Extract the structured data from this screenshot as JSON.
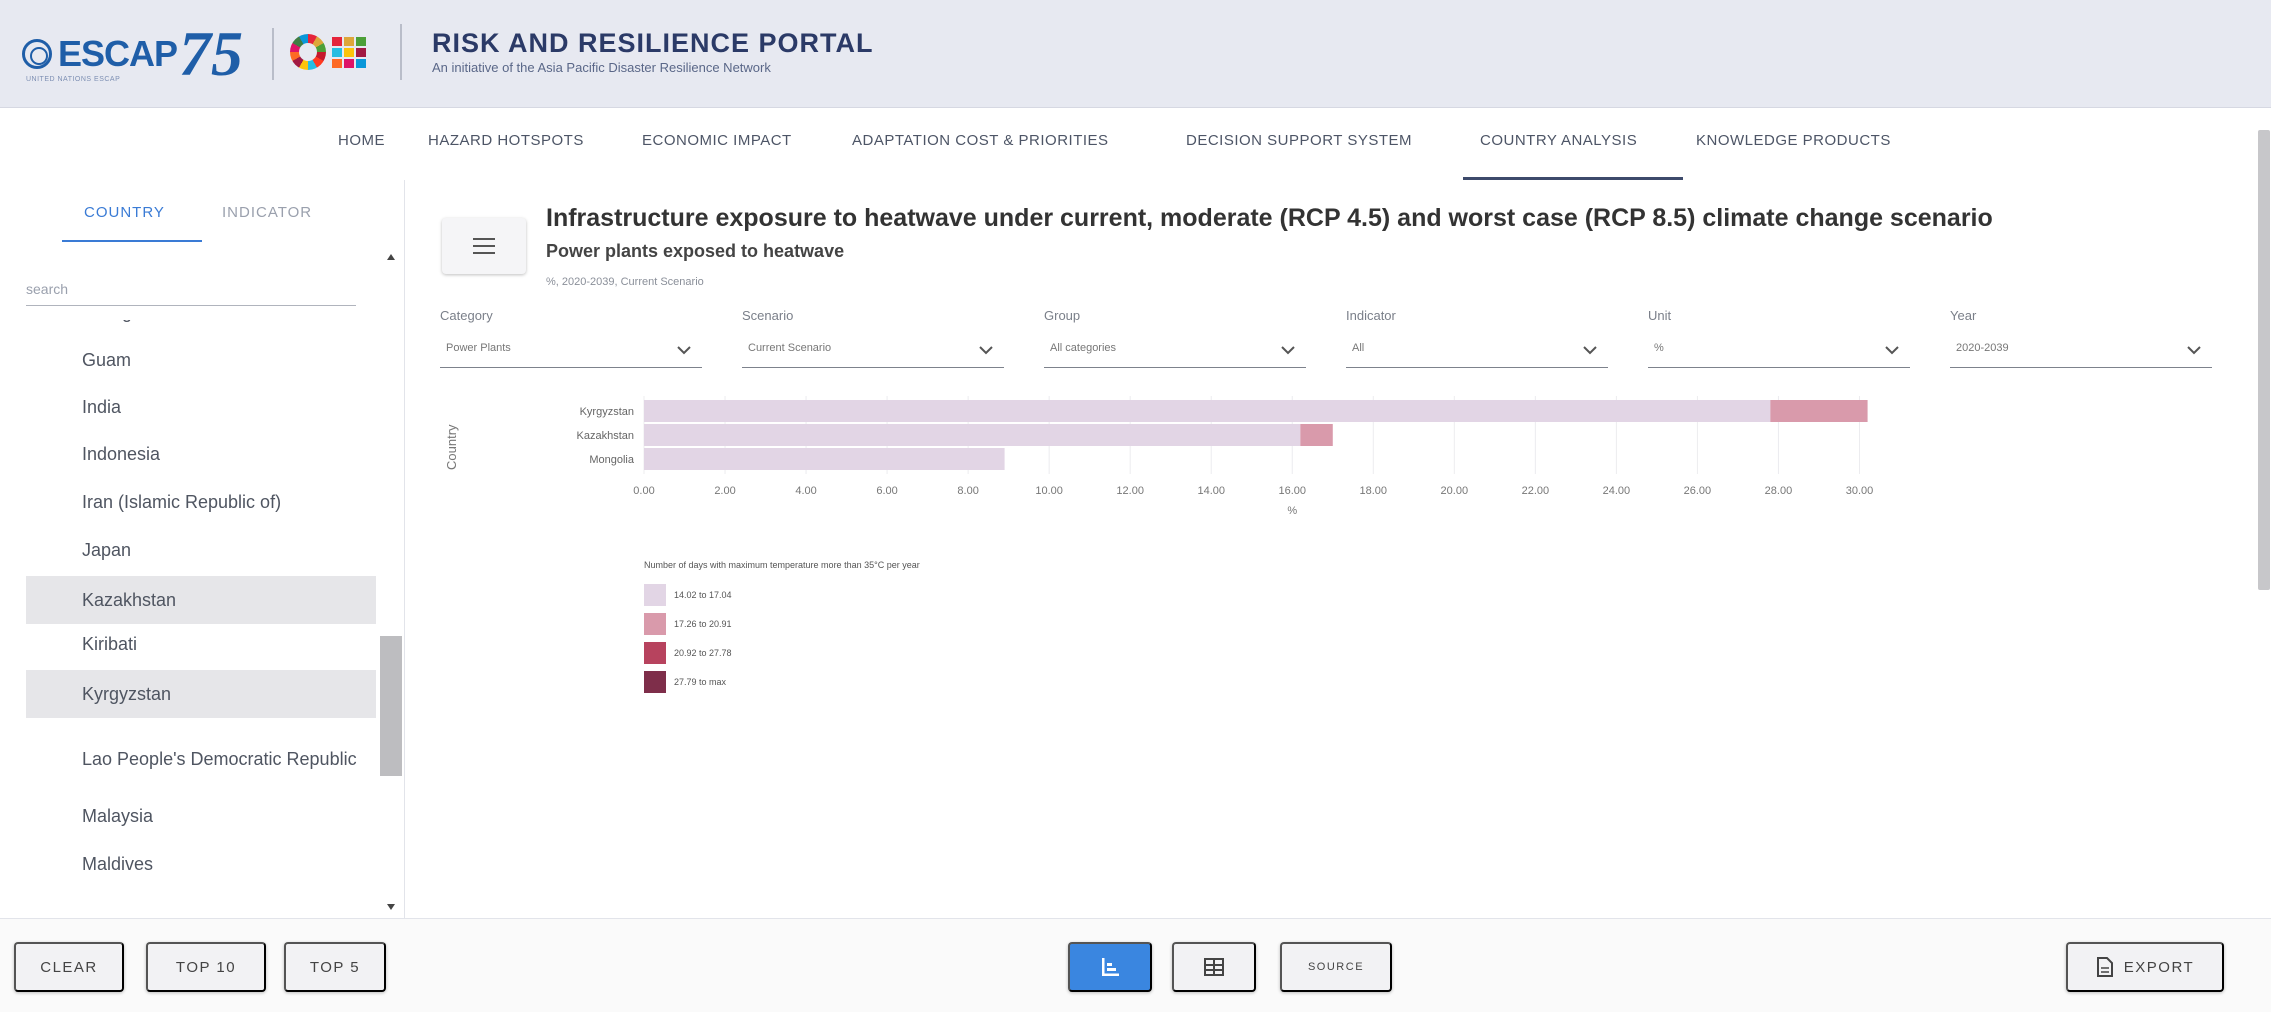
{
  "header": {
    "logo_text": "ESCAP",
    "logo_number": "75",
    "logo_subtext": "UNITED NATIONS ESCAP",
    "portal_title": "RISK AND RESILIENCE PORTAL",
    "portal_subtitle": "An initiative of the Asia Pacific Disaster Resilience Network"
  },
  "nav": {
    "items": [
      "HOME",
      "HAZARD HOTSPOTS",
      "ECONOMIC IMPACT",
      "ADAPTATION COST & PRIORITIES",
      "DECISION SUPPORT SYSTEM",
      "COUNTRY ANALYSIS",
      "KNOWLEDGE PRODUCTS"
    ],
    "active": "COUNTRY ANALYSIS"
  },
  "sidebar": {
    "tabs": [
      "COUNTRY",
      "INDICATOR"
    ],
    "active_tab": "COUNTRY",
    "search_placeholder": "search",
    "countries": [
      "Georgia",
      "Guam",
      "India",
      "Indonesia",
      "Iran (Islamic Republic of)",
      "Japan",
      "Kazakhstan",
      "Kiribati",
      "Kyrgyzstan",
      "Lao People's Democratic Republic",
      "Malaysia",
      "Maldives"
    ],
    "selected": [
      "Kazakhstan",
      "Kyrgyzstan"
    ]
  },
  "main": {
    "title": "Infrastructure exposure to heatwave under current, moderate (RCP 4.5) and worst case (RCP 8.5) climate change scenario",
    "subtitle": "Power plants exposed to heatwave",
    "note": "%, 2020-2039, Current Scenario",
    "filters": [
      {
        "label": "Category",
        "value": "Power Plants"
      },
      {
        "label": "Scenario",
        "value": "Current Scenario"
      },
      {
        "label": "Group",
        "value": "All categories"
      },
      {
        "label": "Indicator",
        "value": "All"
      },
      {
        "label": "Unit",
        "value": "%"
      },
      {
        "label": "Year",
        "value": "2020-2039"
      }
    ]
  },
  "chart_data": {
    "type": "bar",
    "orientation": "horizontal",
    "stacked": true,
    "categories": [
      "Kyrgyzstan",
      "Kazakhstan",
      "Mongolia"
    ],
    "series": [
      {
        "name": "14.02 to 17.04",
        "color": "#e2d5e5",
        "values": [
          27.8,
          16.2,
          8.9
        ]
      },
      {
        "name": "17.26 to 20.91",
        "color": "#d99aab",
        "values": [
          2.4,
          0.8,
          0
        ]
      },
      {
        "name": "20.92 to 27.78",
        "color": "#b7435e",
        "values": [
          0,
          0,
          0
        ]
      },
      {
        "name": "27.79 to max",
        "color": "#7e2e4a",
        "values": [
          0,
          0,
          0
        ]
      }
    ],
    "xlabel": "%",
    "ylabel": "Country",
    "xlim": [
      0,
      31
    ],
    "xticks": [
      "0.00",
      "2.00",
      "4.00",
      "6.00",
      "8.00",
      "10.00",
      "12.00",
      "14.00",
      "16.00",
      "18.00",
      "20.00",
      "22.00",
      "24.00",
      "26.00",
      "28.00",
      "30.00"
    ],
    "legend_title": "Number of days with maximum temperature more than 35°C per year",
    "grid": true
  },
  "footer": {
    "clear": "CLEAR",
    "top10": "TOP 10",
    "top5": "TOP 5",
    "source": "SOURCE",
    "export": "EXPORT"
  },
  "colors": {
    "accent": "#3a86e0",
    "brand": "#1f5ea8",
    "nav_active": "#3d4a6b"
  }
}
